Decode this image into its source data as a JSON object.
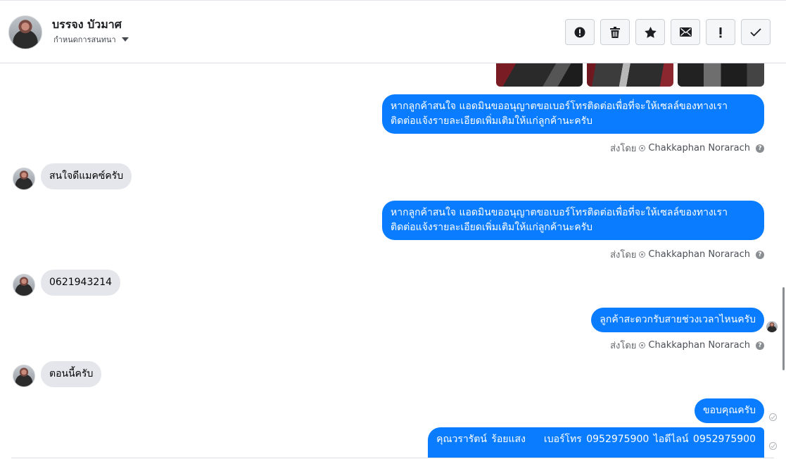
{
  "header": {
    "contact_name": "บรรจง บัวมาศ",
    "assign_label": "กำหนดการสนทนา",
    "actions": [
      {
        "name": "report-icon",
        "label": "!"
      },
      {
        "name": "trash-icon",
        "label": ""
      },
      {
        "name": "star-icon",
        "label": ""
      },
      {
        "name": "envelope-icon",
        "label": ""
      },
      {
        "name": "exclamation-icon",
        "label": "!"
      },
      {
        "name": "check-icon",
        "label": ""
      }
    ]
  },
  "thread": {
    "messages": [
      {
        "dir": "out",
        "text_line1": "หากลูกค้าสนใจ แอดมินขออนุญาตขอเบอร์โทรติดต่อเพื่อที่จะให้เซลล์ของทางเรา",
        "text_line2": "ติดต่อแจ้งรายละเอียดเพิ่มเติมให้แก่ลูกค้านะครับ"
      },
      {
        "dir": "in",
        "text": "สนใจดีแมคซ์ครับ"
      },
      {
        "dir": "out",
        "text_line1": "หากลูกค้าสนใจ แอดมินขออนุญาตขอเบอร์โทรติดต่อเพื่อที่จะให้เซลล์ของทางเรา",
        "text_line2": "ติดต่อแจ้งรายละเอียดเพิ่มเติมให้แก่ลูกค้านะครับ"
      },
      {
        "dir": "in",
        "text": "0621943214"
      },
      {
        "dir": "out",
        "text": "ลูกค้าสะดวกรับสายช่วงเวลาไหนครับ"
      },
      {
        "dir": "in",
        "text": "ตอนนี้ครับ"
      },
      {
        "dir": "out",
        "text": "ขอบคุณครับ"
      },
      {
        "dir": "out",
        "text_a": "คุณวรารัตน์ ร้อยแสง",
        "text_b": "เบอร์โทร 0952975900  ไอดีไลน์ 0952975900"
      }
    ],
    "sent_by_prefix": "ส่งโดย",
    "agent_name": "Chakkaphan Norarach",
    "help_glyph": "?"
  }
}
